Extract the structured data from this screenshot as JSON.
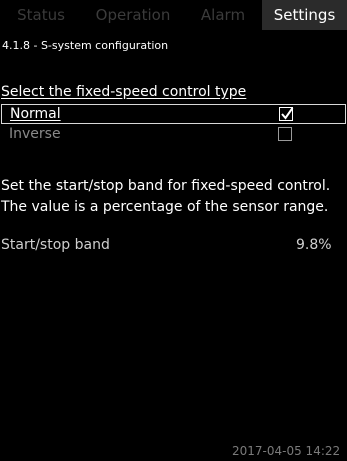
{
  "tabs": [
    {
      "label": "Status"
    },
    {
      "label": "Operation"
    },
    {
      "label": "Alarm"
    },
    {
      "label": "Settings"
    }
  ],
  "breadcrumb": "4.1.8 - S-system configuration",
  "control_type": {
    "title": "Select the fixed-speed control type",
    "options": [
      {
        "label": "Normal",
        "checked": true
      },
      {
        "label": "Inverse",
        "checked": false
      }
    ]
  },
  "description": {
    "line1": "Set the start/stop band for fixed-speed control.",
    "line2": "The value is a percentage of the sensor range."
  },
  "param": {
    "label": "Start/stop band",
    "value": "9.8%"
  },
  "datetime": "2017-04-05 14:22",
  "colors": {
    "background": "#000000",
    "active_tab": "#2b2b2b",
    "inactive_tab_text": "#3b3b3b"
  },
  "icons": [
    "checkmark-icon"
  ]
}
